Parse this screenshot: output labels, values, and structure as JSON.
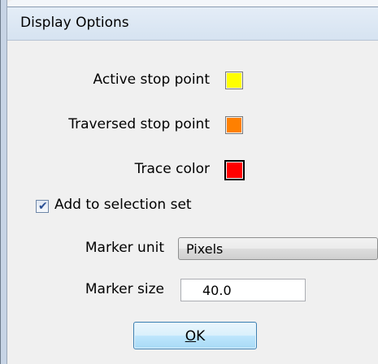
{
  "window": {
    "title": "Display Options"
  },
  "colors": {
    "active_stop_point": "#ffff00",
    "traversed_stop_point": "#ff8000",
    "trace_color": "#ff0000"
  },
  "rows": {
    "active_stop_point_label": "Active stop point",
    "traversed_stop_point_label": "Traversed stop point",
    "trace_color_label": "Trace color"
  },
  "add_to_selection": {
    "label": "Add to selection set",
    "checked": true
  },
  "marker_unit": {
    "label": "Marker unit",
    "value": "Pixels"
  },
  "marker_size": {
    "label": "Marker size",
    "value": "40.0"
  },
  "ok_button": {
    "mnemonic": "O",
    "rest": "K"
  }
}
